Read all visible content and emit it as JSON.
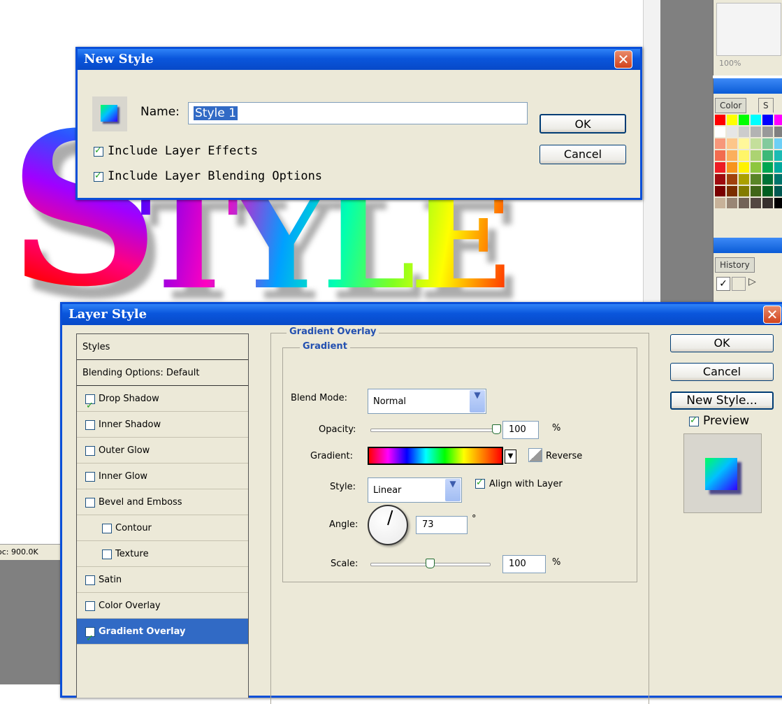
{
  "canvas": {
    "art_first_letter": "S",
    "art_rest": "TYLE",
    "doc_status": "oc: 900.0K"
  },
  "palettes": {
    "navigator_zoom": "100%",
    "color_tab": "Color",
    "swatches_tab_partial": "S",
    "history_tab": "History",
    "swatch_colors": [
      "#ff0000",
      "#ffff00",
      "#00ff00",
      "#00ffff",
      "#0000ff",
      "#ff00ff",
      "#ffffff",
      "#e6e6e6",
      "#cccccc",
      "#b3b3b3",
      "#999999",
      "#808080",
      "#f7977a",
      "#fdc68a",
      "#fff79a",
      "#c4df9b",
      "#82ca9d",
      "#6dcff6",
      "#f26c4f",
      "#fbaf5d",
      "#fff568",
      "#acd372",
      "#3cb878",
      "#1cbbb4",
      "#ed1c24",
      "#f7941d",
      "#fff200",
      "#8dc63f",
      "#00a651",
      "#00a99d",
      "#9e0b0f",
      "#a0410d",
      "#aba000",
      "#598527",
      "#007236",
      "#00746b",
      "#790000",
      "#7b2e00",
      "#827b00",
      "#406618",
      "#005e20",
      "#005952",
      "#c7b299",
      "#998675",
      "#736357",
      "#534741",
      "#37302d",
      "#000000"
    ],
    "history_checks": [
      "✓"
    ]
  },
  "new_style_dialog": {
    "title": "New Style",
    "close_glyph": "✕",
    "name_label": "Name:",
    "name_value": "Style 1",
    "ok_label": "OK",
    "cancel_label": "Cancel",
    "include_effects_label": "Include Layer Effects",
    "include_effects_checked": true,
    "include_blending_label": "Include Layer Blending Options",
    "include_blending_checked": true
  },
  "layer_style_dialog": {
    "title": "Layer Style",
    "close_glyph": "✕",
    "styles_list": [
      {
        "label": "Styles",
        "checkbox": false,
        "header": true
      },
      {
        "label": "Blending Options: Default",
        "checkbox": false,
        "header": true
      },
      {
        "label": "Drop Shadow",
        "checkbox": true,
        "checked": true
      },
      {
        "label": "Inner Shadow",
        "checkbox": true,
        "checked": false
      },
      {
        "label": "Outer Glow",
        "checkbox": true,
        "checked": false
      },
      {
        "label": "Inner Glow",
        "checkbox": true,
        "checked": false
      },
      {
        "label": "Bevel and Emboss",
        "checkbox": true,
        "checked": false
      },
      {
        "label": "Contour",
        "checkbox": true,
        "checked": false,
        "indent": true
      },
      {
        "label": "Texture",
        "checkbox": true,
        "checked": false,
        "indent": true
      },
      {
        "label": "Satin",
        "checkbox": true,
        "checked": false
      },
      {
        "label": "Color Overlay",
        "checkbox": true,
        "checked": false
      },
      {
        "label": "Gradient Overlay",
        "checkbox": true,
        "checked": true,
        "selected": true
      }
    ],
    "section_title": "Gradient Overlay",
    "subsection_title": "Gradient",
    "blend_mode_label": "Blend Mode:",
    "blend_mode_value": "Normal",
    "opacity_label": "Opacity:",
    "opacity_value": "100",
    "opacity_level": 1.0,
    "percent": "%",
    "gradient_label": "Gradient:",
    "reverse_label": "Reverse",
    "reverse_checked": false,
    "style_label": "Style:",
    "style_value": "Linear",
    "align_label": "Align with Layer",
    "align_checked": true,
    "angle_label": "Angle:",
    "angle_value": "73",
    "degree": "°",
    "scale_label": "Scale:",
    "scale_value": "100",
    "scale_level": 0.5,
    "ok_label": "OK",
    "cancel_label": "Cancel",
    "new_style_label": "New Style...",
    "preview_label": "Preview",
    "preview_checked": true,
    "gradient_colors": [
      "#ff0000",
      "#ff00ff",
      "#0000ff",
      "#00ffff",
      "#00ff00",
      "#ffff00",
      "#ff8000",
      "#ff0000"
    ]
  }
}
